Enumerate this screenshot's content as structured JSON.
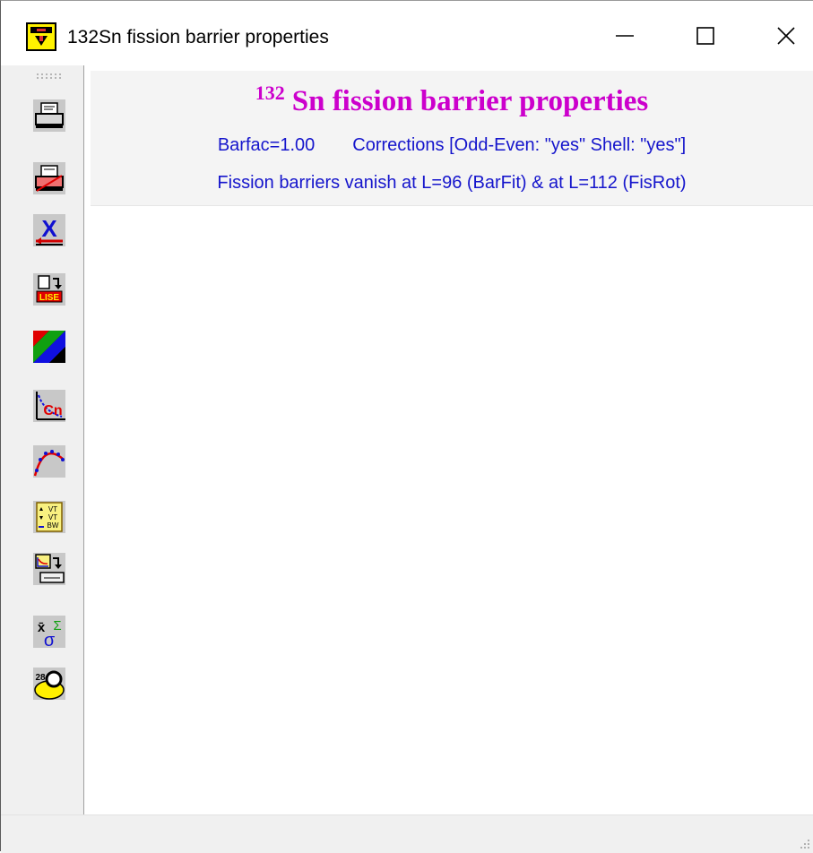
{
  "window": {
    "title": "132Sn fission barrier properties"
  },
  "titlebar_buttons": {
    "minimize": "minimize-icon",
    "maximize": "maximize-icon",
    "close": "close-icon"
  },
  "toolbar": {
    "tools": [
      "printer-icon",
      "printer-color-icon",
      "close-x-icon",
      "export-lise-icon",
      "color-palette-icon",
      "plot-cn-icon",
      "curve-fit-icon",
      "vt-settings-icon",
      "copy-plot-icon",
      "statistics-icon",
      "nucleus-icon"
    ],
    "export_badge": "LISE",
    "plot_badge": "Cn",
    "vt_labels": [
      "VT",
      "VT",
      "BW"
    ],
    "stats_labels": {
      "mean": "x̄",
      "sum": "Σ",
      "sigma": "σ"
    },
    "nucleus_label": "28"
  },
  "header": {
    "title_mass": "132",
    "title_text": "Sn fission barrier properties",
    "barfac": "Barfac=1.00",
    "corrections": "Corrections [Odd-Even: \"yes\"  Shell: \"yes\"]",
    "vanish": "Fission barriers vanish at L=96 (BarFit) & at L=112 (FisRot)"
  },
  "colors": {
    "title": "#cc00cc",
    "info_text": "#1515cc",
    "toolbar_bg": "#f0f0f0"
  }
}
